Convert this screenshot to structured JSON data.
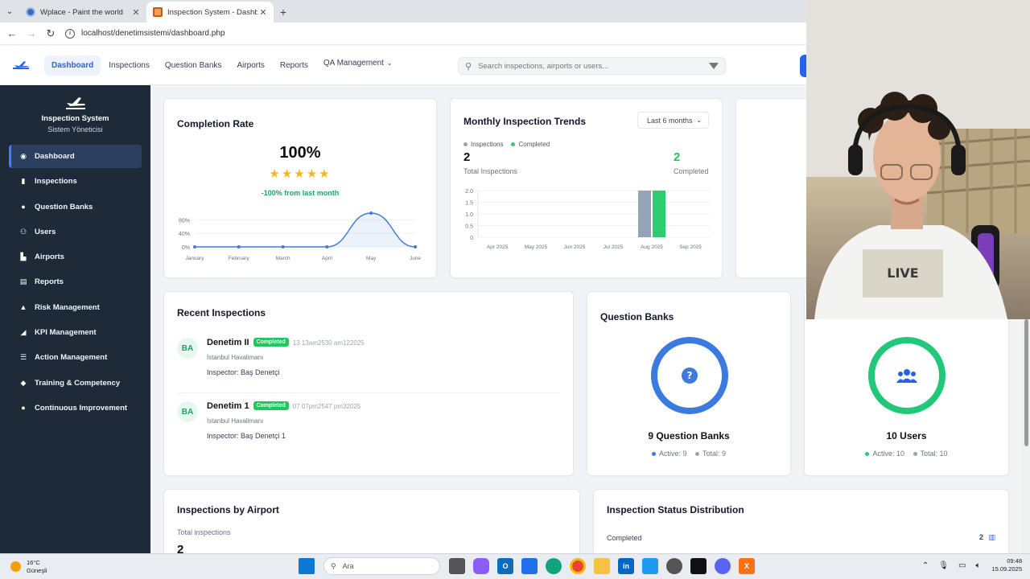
{
  "browser": {
    "tabs": [
      {
        "label": "Wplace - Paint the world",
        "active": false
      },
      {
        "label": "Inspection System - Dashboard",
        "active": true
      }
    ],
    "new_tab": "+",
    "url": "localhost/denetimsistemi/dashboard.php"
  },
  "topnav": {
    "links": [
      {
        "label": "Dashboard",
        "active": true
      },
      {
        "label": "Inspections"
      },
      {
        "label": "Question Banks"
      },
      {
        "label": "Airports"
      },
      {
        "label": "Reports"
      },
      {
        "label": "QA Management"
      }
    ],
    "search_placeholder": "Search inspections, airports or users..."
  },
  "sidebar": {
    "title": "Inspection System",
    "subtitle": "Sistem Yöneticisi",
    "items": [
      {
        "label": "Dashboard",
        "icon": "gauge-icon",
        "active": true
      },
      {
        "label": "Inspections",
        "icon": "clipboard-icon"
      },
      {
        "label": "Question Banks",
        "icon": "question-icon"
      },
      {
        "label": "Users",
        "icon": "users-icon"
      },
      {
        "label": "Airports",
        "icon": "building-icon"
      },
      {
        "label": "Reports",
        "icon": "chart-icon"
      },
      {
        "label": "Risk Management",
        "icon": "warning-icon"
      },
      {
        "label": "KPI Management",
        "icon": "kpi-icon"
      },
      {
        "label": "Action Management",
        "icon": "tasks-icon"
      },
      {
        "label": "Training & Competency",
        "icon": "graduation-icon"
      },
      {
        "label": "Continuous Improvement",
        "icon": "lightbulb-icon"
      }
    ]
  },
  "completion": {
    "title": "Completion Rate",
    "value": "100%",
    "stars": "★★★★★",
    "delta": "-100% from last month"
  },
  "monthly": {
    "title": "Monthly Inspection Trends",
    "range": "Last 6 months",
    "legend_inspections": "Inspections",
    "legend_completed": "Completed",
    "total_num": "2",
    "total_label": "Total Inspections",
    "completed_num": "2",
    "completed_label": "Completed"
  },
  "recent": {
    "title": "Recent Inspections",
    "items": [
      {
        "initials": "BA",
        "name": "Denetim II",
        "badge": "Completed",
        "date": "13 13am2530 am122025",
        "airport": "İstanbul Havalimanı",
        "inspector": "Inspector: Baş Denetçi"
      },
      {
        "initials": "BA",
        "name": "Denetim 1",
        "badge": "Completed",
        "date": "07 07pm2547 pm32025",
        "airport": "İstanbul Havalimanı",
        "inspector": "Inspector: Baş Denetçi 1"
      }
    ]
  },
  "question_banks": {
    "title": "Question Banks",
    "count_label": "9 Question Banks",
    "active": "Active: 9",
    "total": "Total: 9"
  },
  "users": {
    "count_label": "10 Users",
    "active": "Active: 10",
    "total": "Total: 10"
  },
  "by_airport": {
    "title": "Inspections by Airport",
    "subtitle": "Total inspections",
    "value": "2"
  },
  "status_dist": {
    "title": "Inspection Status Distribution",
    "row_label": "Completed",
    "row_value": "2"
  },
  "taskbar": {
    "temp": "16°C",
    "weather": "Güneşli",
    "search": "Ara",
    "time": "09:48",
    "date": "15.09.2025"
  },
  "chart_data": [
    {
      "type": "area",
      "categories": [
        "January",
        "February",
        "March",
        "April",
        "May",
        "June"
      ],
      "values": [
        0,
        0,
        0,
        0,
        100,
        0
      ],
      "yticks": [
        "80%",
        "40%",
        "0%"
      ],
      "ylim": [
        0,
        100
      ]
    },
    {
      "type": "bar",
      "categories": [
        "Apr 2025",
        "May 2025",
        "Jun 2025",
        "Jul 2025",
        "Aug 2025",
        "Sep 2025"
      ],
      "series": [
        {
          "name": "Inspections",
          "values": [
            0,
            0,
            0,
            0,
            2,
            0
          ],
          "color": "#94a3b8"
        },
        {
          "name": "Completed",
          "values": [
            0,
            0,
            0,
            0,
            2,
            0
          ],
          "color": "#2ecc71"
        }
      ],
      "yticks": [
        "2.0",
        "1.5",
        "1.0",
        "0.5",
        "0"
      ],
      "ylim": [
        0,
        2
      ]
    }
  ],
  "colors": {
    "accent": "#2563eb",
    "sidebar_bg": "#1e2a38",
    "success": "#22c55e",
    "ring_blue": "#3b7be0",
    "ring_green": "#22c77a"
  }
}
